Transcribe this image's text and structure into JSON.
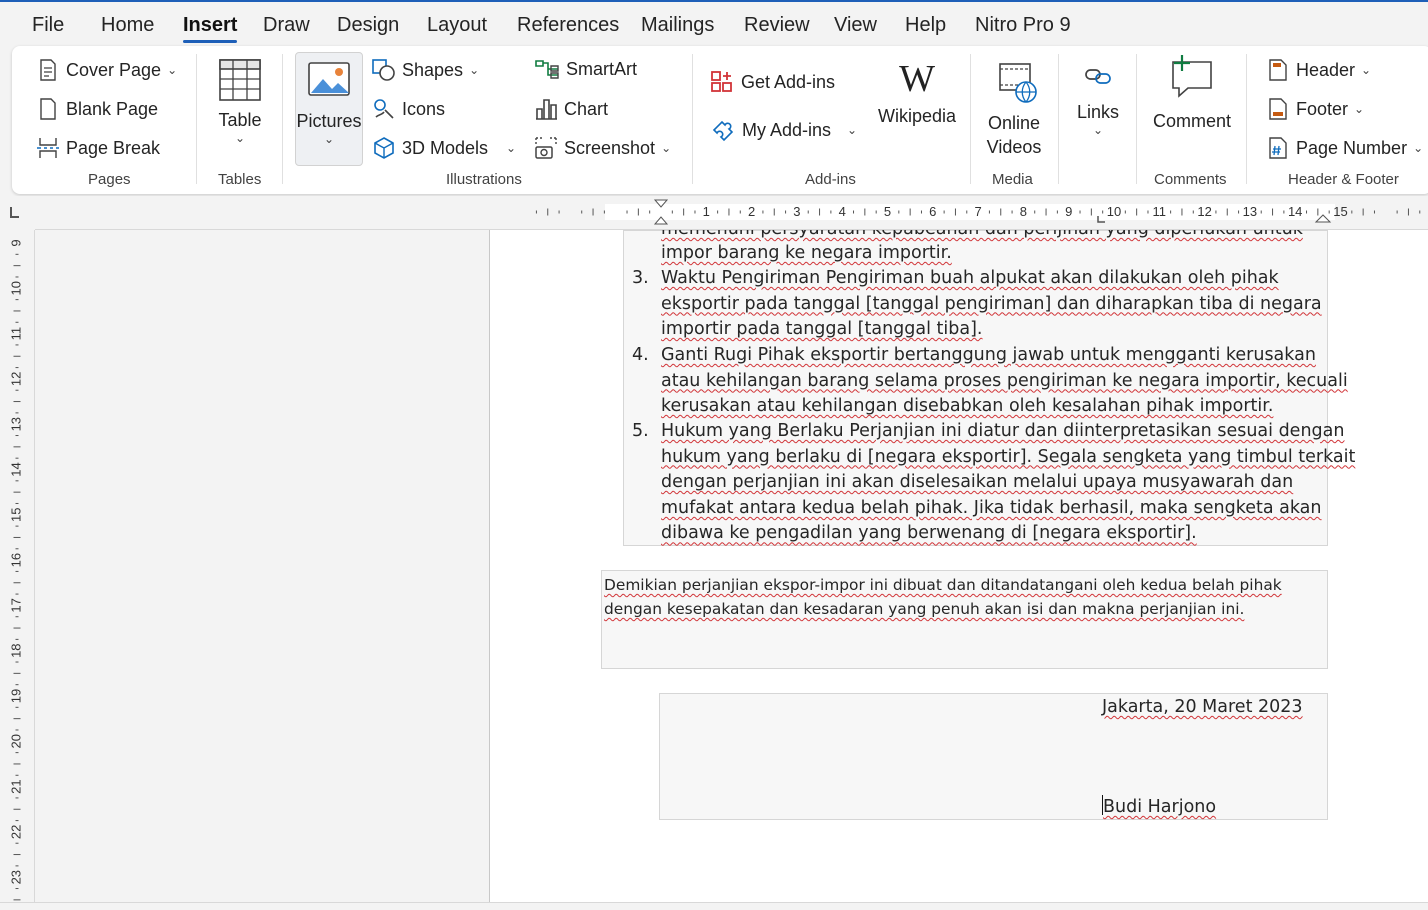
{
  "menu": {
    "tabs": [
      "File",
      "Home",
      "Insert",
      "Draw",
      "Design",
      "Layout",
      "References",
      "Mailings",
      "Review",
      "View",
      "Help",
      "Nitro Pro 9"
    ],
    "active": "Insert"
  },
  "ribbon": {
    "pages": {
      "cover_page": "Cover Page",
      "blank_page": "Blank Page",
      "page_break": "Page Break",
      "label": "Pages"
    },
    "tables": {
      "table": "Table",
      "label": "Tables"
    },
    "illustrations": {
      "pictures": "Pictures",
      "shapes": "Shapes",
      "icons": "Icons",
      "models_3d": "3D Models",
      "smartart": "SmartArt",
      "chart": "Chart",
      "screenshot": "Screenshot",
      "label": "Illustrations"
    },
    "addins": {
      "get_addins": "Get Add-ins",
      "my_addins": "My Add-ins",
      "wikipedia": "Wikipedia",
      "label": "Add-ins"
    },
    "media": {
      "online_videos_1": "Online",
      "online_videos_2": "Videos",
      "label": "Media"
    },
    "links": {
      "links": "Links"
    },
    "comments": {
      "comment": "Comment",
      "label": "Comments"
    },
    "header_footer": {
      "header": "Header",
      "footer": "Footer",
      "page_number": "Page Number",
      "label": "Header & Footer"
    }
  },
  "ruler": {
    "h_ticks": [
      "1",
      "2",
      "3",
      "4",
      "5",
      "6",
      "7",
      "8",
      "9",
      "10",
      "11",
      "12",
      "13",
      "14",
      "15"
    ],
    "v_ticks": [
      "9",
      "10",
      "11",
      "12",
      "13",
      "14",
      "15",
      "16",
      "17",
      "18",
      "19",
      "20",
      "21",
      "22",
      "23"
    ]
  },
  "document": {
    "cut_line_1": "memenuhi persyaratan kepabeanan dan perijinan yang diperlukan untuk",
    "cut_line_2": "impor barang ke negara importir.",
    "list": [
      {
        "num": "3.",
        "lines": [
          "Waktu Pengiriman Pengiriman buah alpukat akan dilakukan oleh pihak",
          "eksportir pada tanggal [tanggal pengiriman] dan diharapkan tiba di negara",
          "importir pada tanggal [tanggal tiba]."
        ]
      },
      {
        "num": "4.",
        "lines": [
          "Ganti Rugi Pihak eksportir bertanggung jawab untuk mengganti kerusakan",
          "atau kehilangan barang selama proses pengiriman ke negara importir, kecuali",
          "kerusakan atau kehilangan disebabkan oleh kesalahan pihak importir."
        ]
      },
      {
        "num": "5.",
        "lines": [
          "Hukum yang Berlaku Perjanjian ini diatur dan diinterpretasikan sesuai dengan",
          "hukum yang berlaku di [negara eksportir]. Segala sengketa yang timbul terkait",
          "dengan perjanjian ini akan diselesaikan melalui upaya musyawarah dan",
          "mufakat antara kedua belah pihak. Jika tidak berhasil, maka sengketa akan",
          "dibawa ke pengadilan yang berwenang di [negara eksportir]."
        ]
      }
    ],
    "closing_1": "Demikian perjanjian ekspor-impor ini dibuat dan ditandatangani oleh kedua belah pihak",
    "closing_2": "dengan kesepakatan dan kesadaran yang penuh akan isi dan makna perjanjian ini.",
    "place_date": "Jakarta, 20 Maret 2023",
    "signatory": "Budi Harjono"
  }
}
